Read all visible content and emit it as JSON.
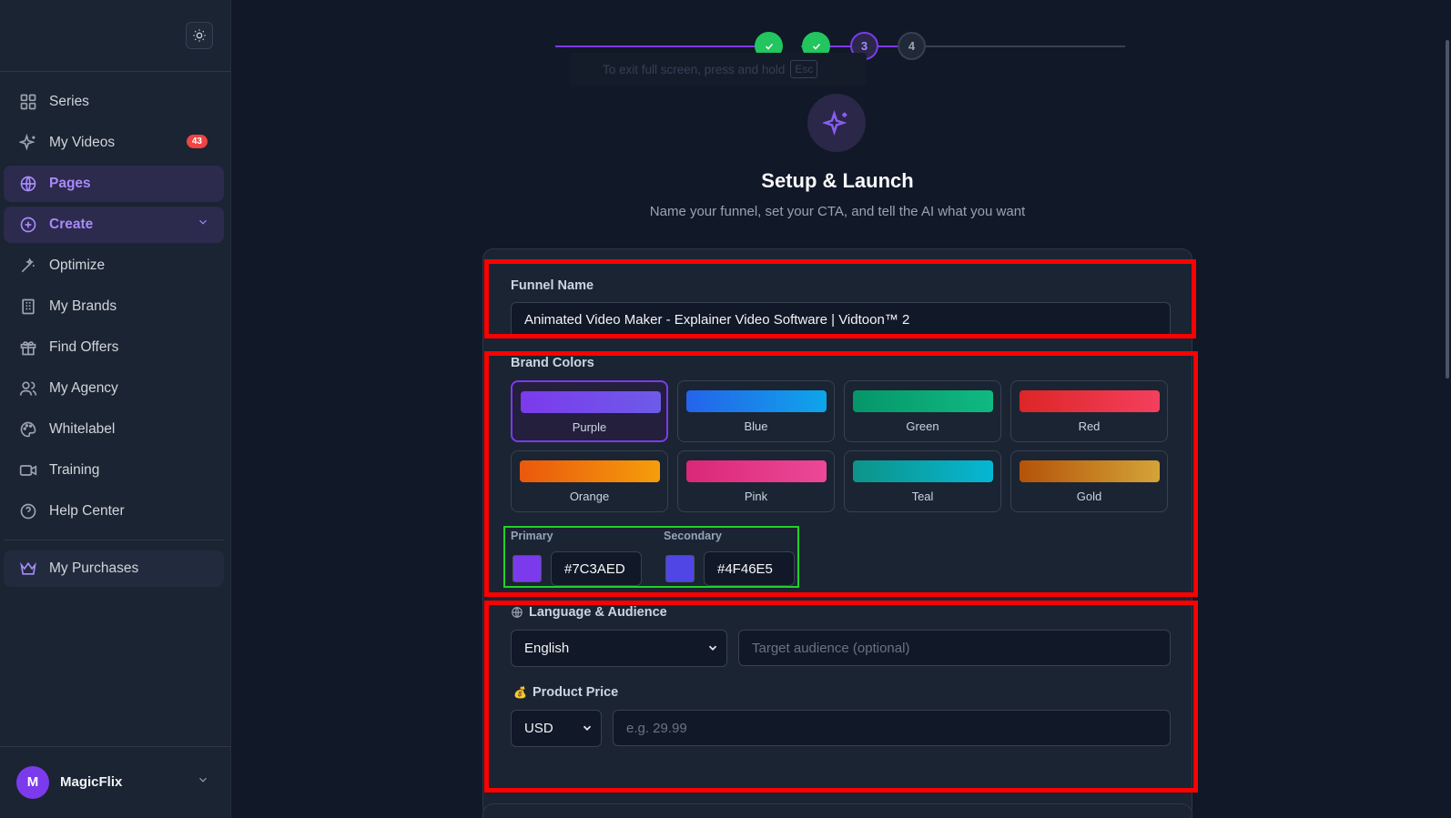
{
  "sidebar": {
    "items": [
      {
        "label": "Series"
      },
      {
        "label": "My Videos",
        "badge": "43"
      },
      {
        "label": "Pages"
      },
      {
        "label": "Create"
      },
      {
        "label": "Optimize"
      },
      {
        "label": "My Brands"
      },
      {
        "label": "Find Offers"
      },
      {
        "label": "My Agency"
      },
      {
        "label": "Whitelabel"
      },
      {
        "label": "Training"
      },
      {
        "label": "Help Center"
      }
    ],
    "purchases": "My Purchases",
    "user": {
      "initial": "M",
      "name": "MagicFlix"
    }
  },
  "stepper": {
    "steps": [
      "1",
      "2",
      "3",
      "4"
    ],
    "current": 3,
    "esc_notice": "To exit full screen, press and hold",
    "esc_key": "Esc"
  },
  "header": {
    "title": "Setup & Launch",
    "subtitle": "Name your funnel, set your CTA, and tell the AI what you want"
  },
  "form": {
    "funnel_name_label": "Funnel Name",
    "funnel_name_value": "Animated Video Maker - Explainer Video Software | Vidtoon™ 2",
    "brand_colors_label": "Brand Colors",
    "swatches": [
      {
        "name": "Purple",
        "from": "#7c3aed",
        "to": "#6d5be8"
      },
      {
        "name": "Blue",
        "from": "#2563eb",
        "to": "#0ea5e9"
      },
      {
        "name": "Green",
        "from": "#059669",
        "to": "#10b981"
      },
      {
        "name": "Red",
        "from": "#dc2626",
        "to": "#f43f5e"
      },
      {
        "name": "Orange",
        "from": "#ea580c",
        "to": "#f59e0b"
      },
      {
        "name": "Pink",
        "from": "#db2777",
        "to": "#ec4899"
      },
      {
        "name": "Teal",
        "from": "#0d9488",
        "to": "#06b6d4"
      },
      {
        "name": "Gold",
        "from": "#b45309",
        "to": "#d4a437"
      }
    ],
    "selected_swatch": "Purple",
    "primary_label": "Primary",
    "primary_value": "#7C3AED",
    "secondary_label": "Secondary",
    "secondary_value": "#4F46E5",
    "language_label": "Language & Audience",
    "language_value": "English",
    "audience_placeholder": "Target audience (optional)",
    "price_label": "Product Price",
    "currency_value": "USD",
    "price_placeholder": "e.g. 29.99"
  }
}
